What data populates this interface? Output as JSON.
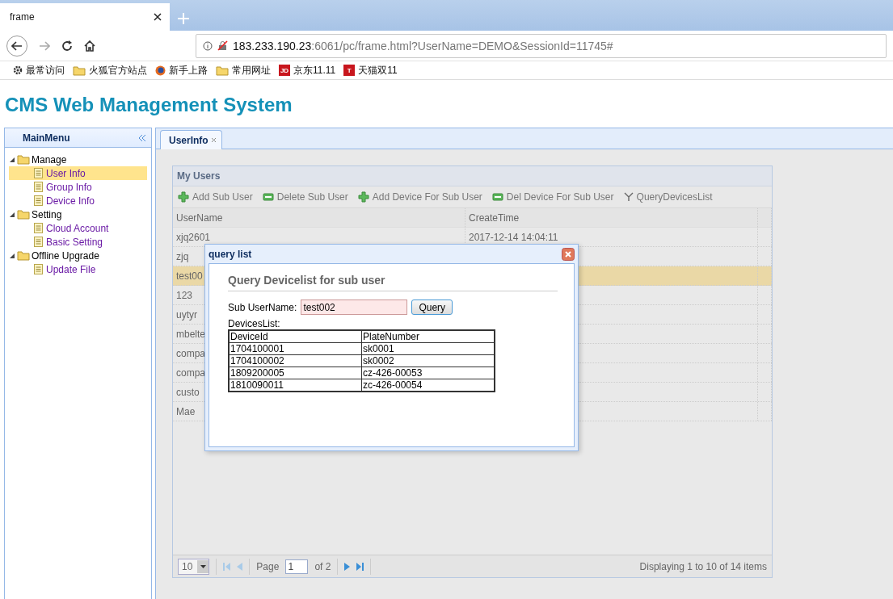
{
  "browser": {
    "tabs": [
      {
        "label": "frame",
        "selected": true
      }
    ],
    "url": {
      "host": "183.233.190.23",
      "path": ":6061/pc/frame.html?UserName=DEMO&SessionId=11745#"
    },
    "bookmarks": [
      {
        "kind": "gear",
        "label": "最常访问"
      },
      {
        "kind": "folder",
        "label": "火狐官方站点"
      },
      {
        "kind": "globe",
        "label": "新手上路"
      },
      {
        "kind": "folder",
        "label": "常用网址"
      },
      {
        "kind": "badge",
        "badge": "JD",
        "label": "京东11.11"
      },
      {
        "kind": "badge",
        "badge": "T",
        "label": "天猫双11"
      }
    ]
  },
  "page_title": "CMS Web Management System",
  "sidebar": {
    "title": "MainMenu",
    "items": [
      {
        "label": "Manage",
        "expanded": true,
        "children": [
          {
            "label": "User Info",
            "selected": true
          },
          {
            "label": "Group Info",
            "selected": false
          },
          {
            "label": "Device Info",
            "selected": false
          }
        ]
      },
      {
        "label": "Setting",
        "expanded": true,
        "children": [
          {
            "label": "Cloud Account",
            "selected": false
          },
          {
            "label": "Basic Setting",
            "selected": false
          }
        ]
      },
      {
        "label": "Offline Upgrade",
        "expanded": true,
        "children": [
          {
            "label": "Update File",
            "selected": false
          }
        ]
      }
    ]
  },
  "tabs": [
    {
      "label": "UserInfo",
      "selected": true
    }
  ],
  "panel": {
    "title": "My Users",
    "toolbar": [
      {
        "kind": "add",
        "label": "Add Sub User"
      },
      {
        "kind": "remove",
        "label": "Delete Sub User"
      },
      {
        "kind": "add",
        "label": "Add Device For Sub User"
      },
      {
        "kind": "remove",
        "label": "Del Device For Sub User"
      },
      {
        "kind": "filter",
        "label": "QueryDevicesList"
      }
    ],
    "columns": [
      "UserName",
      "CreateTime"
    ],
    "rows": [
      {
        "username": "xjq2601",
        "create_time": "2017-12-14 14:04:11",
        "selected": false
      },
      {
        "username": "zjq",
        "selected": false
      },
      {
        "username": "test00",
        "selected": true
      },
      {
        "username": "123",
        "selected": false
      },
      {
        "username": "uytyr",
        "selected": false
      },
      {
        "username": "mbelte",
        "selected": false
      },
      {
        "username": "compa",
        "selected": false
      },
      {
        "username": "compa",
        "selected": false
      },
      {
        "username": "custo",
        "selected": false
      },
      {
        "username": "Mae",
        "selected": false
      }
    ],
    "pager": {
      "page_size": "10",
      "page_label": "Page",
      "page": "1",
      "of": "of 2",
      "summary": "Displaying 1 to 10 of 14 items"
    }
  },
  "dialog": {
    "title": "query list",
    "heading": "Query Devicelist for sub user",
    "field_label": "Sub UserName:",
    "field_value": "test002",
    "button": "Query",
    "list_label": "DevicesList:",
    "columns": [
      "DeviceId",
      "PlateNumber"
    ],
    "rows": [
      [
        "1704100001",
        "sk0001"
      ],
      [
        "1704100002",
        "sk0002"
      ],
      [
        "1809200005",
        "cz-426-00053"
      ],
      [
        "1810090011",
        "zc-426-00054"
      ]
    ]
  }
}
